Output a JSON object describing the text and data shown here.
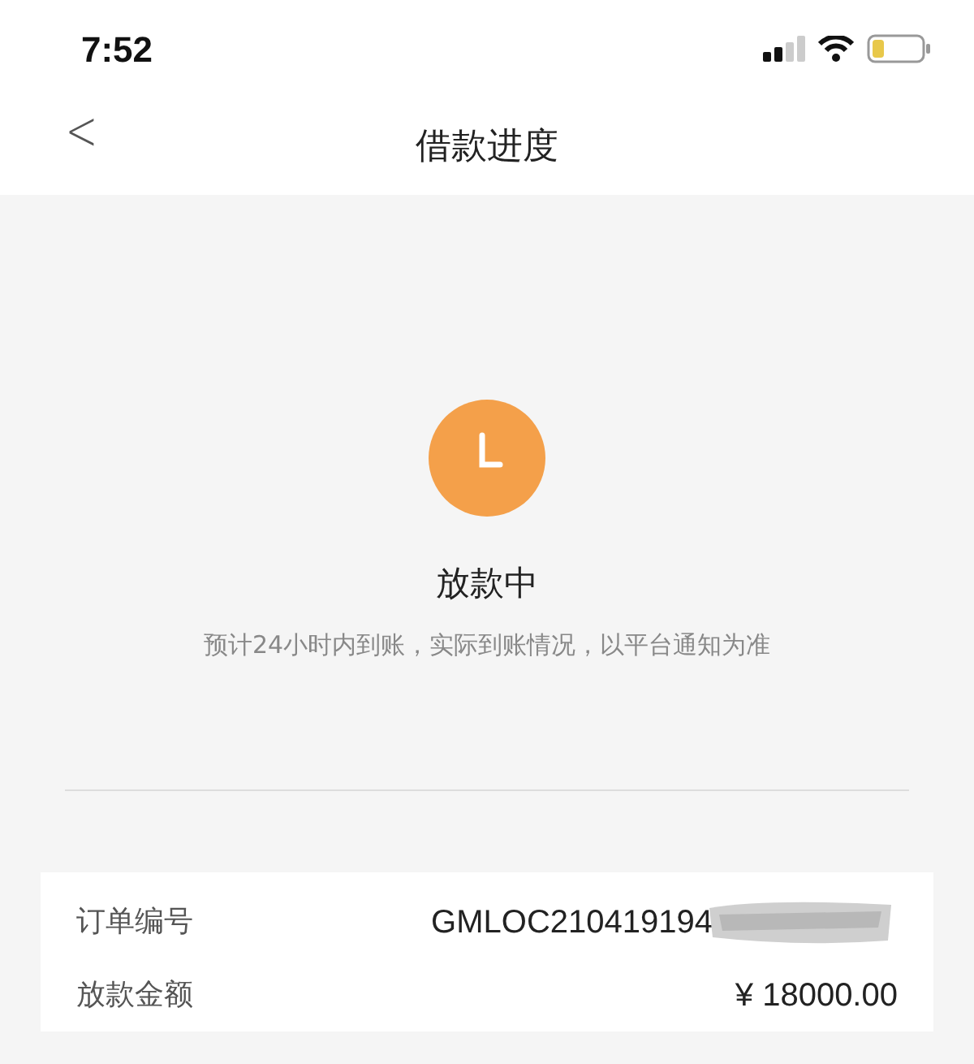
{
  "status_bar": {
    "time": "7:52"
  },
  "nav": {
    "back": "<",
    "title": "借款进度"
  },
  "status": {
    "title": "放款中",
    "note": "预计24小时内到账，实际到账情况，以平台通知为准"
  },
  "details": [
    {
      "label": "订单编号",
      "value": "GMLOC210419194",
      "redacted": true
    },
    {
      "label": "放款金额",
      "value": "¥ 18000.00",
      "redacted": false
    }
  ]
}
